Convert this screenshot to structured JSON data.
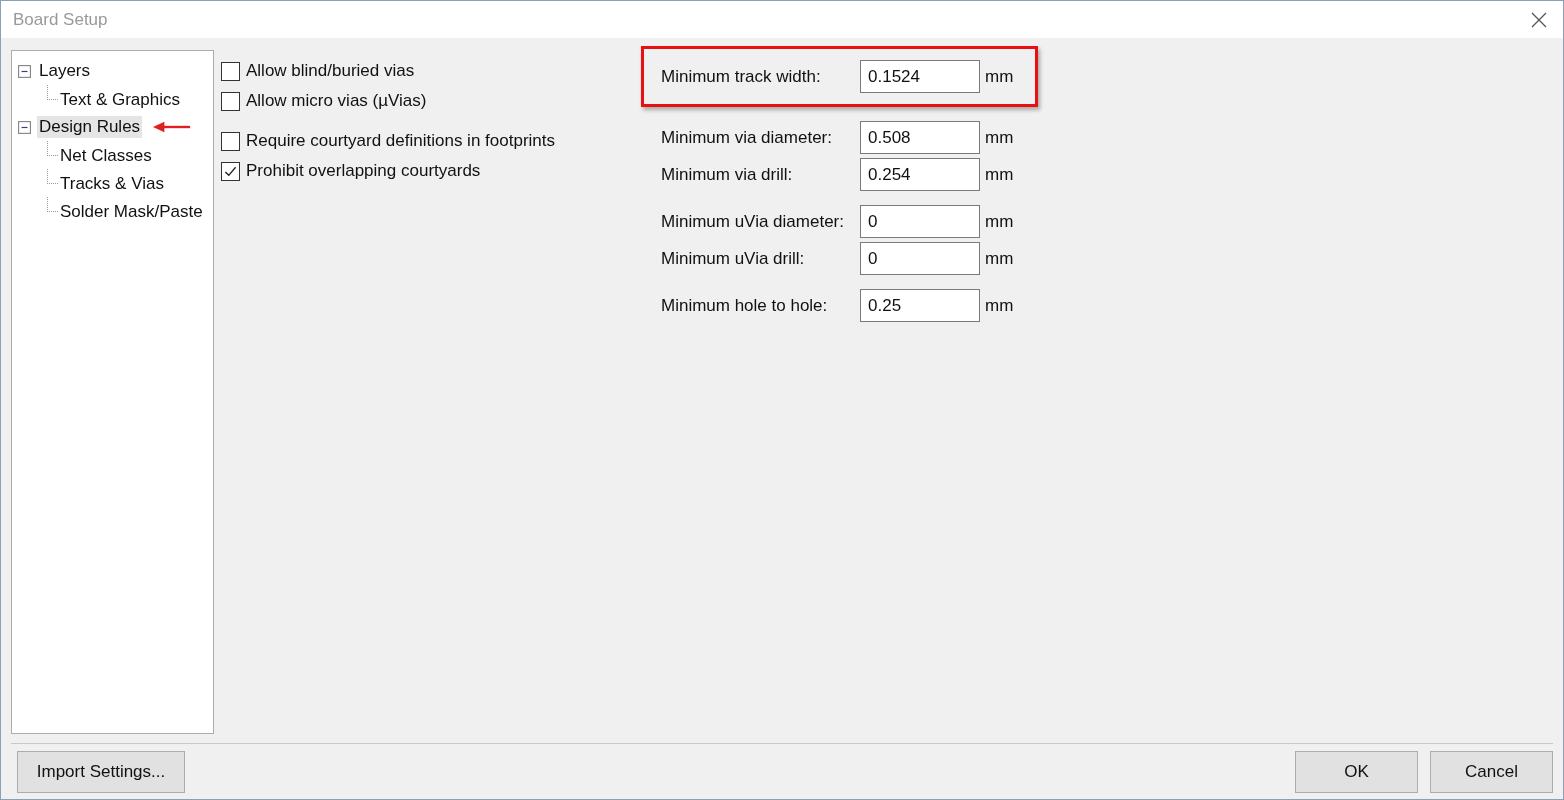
{
  "window": {
    "title": "Board Setup"
  },
  "tree": [
    {
      "label": "Layers",
      "expanded": true,
      "selected": false,
      "arrow": false,
      "children": [
        {
          "label": "Text & Graphics",
          "selected": false,
          "arrow": false
        }
      ]
    },
    {
      "label": "Design Rules",
      "expanded": true,
      "selected": true,
      "arrow": true,
      "children": [
        {
          "label": "Net Classes",
          "selected": false,
          "arrow": false
        },
        {
          "label": "Tracks & Vias",
          "selected": false,
          "arrow": false
        },
        {
          "label": "Solder Mask/Paste",
          "selected": false,
          "arrow": false
        }
      ]
    }
  ],
  "checkbox_groups": [
    [
      {
        "label": "Allow blind/buried vias",
        "checked": false
      },
      {
        "label": "Allow micro vias (µVias)",
        "checked": false
      }
    ],
    [
      {
        "label": "Require courtyard definitions in footprints",
        "checked": false
      },
      {
        "label": "Prohibit overlapping courtyards",
        "checked": true
      }
    ]
  ],
  "field_groups": [
    [
      {
        "label": "Minimum track width:",
        "value": "0.1524",
        "unit": "mm",
        "highlighted": true
      }
    ],
    [
      {
        "label": "Minimum via diameter:",
        "value": "0.508",
        "unit": "mm",
        "highlighted": false
      },
      {
        "label": "Minimum via drill:",
        "value": "0.254",
        "unit": "mm",
        "highlighted": false
      }
    ],
    [
      {
        "label": "Minimum uVia diameter:",
        "value": "0",
        "unit": "mm",
        "highlighted": false
      },
      {
        "label": "Minimum uVia drill:",
        "value": "0",
        "unit": "mm",
        "highlighted": false
      }
    ],
    [
      {
        "label": "Minimum hole to hole:",
        "value": "0.25",
        "unit": "mm",
        "highlighted": false
      }
    ]
  ],
  "buttons": {
    "left": [
      "Import Settings..."
    ],
    "right": [
      "OK",
      "Cancel"
    ]
  }
}
